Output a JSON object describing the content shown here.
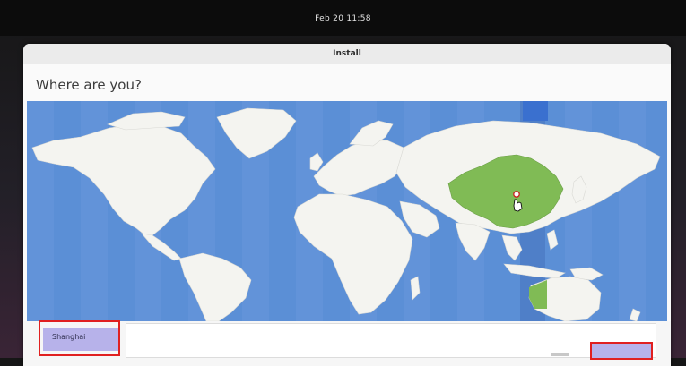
{
  "system": {
    "clock": "Feb 20  11:58"
  },
  "window": {
    "title": "Install"
  },
  "page": {
    "heading": "Where are you?"
  },
  "location": {
    "timezone_entry": "Shanghai"
  },
  "colors": {
    "ocean": "#5b8fd6",
    "land": "#f4f4f0",
    "selected_region": "#80bb55",
    "selected_strip": "#4f7fc8",
    "highlight_box": "#e02020",
    "selection_fill": "#b7b2ea"
  },
  "icons": {
    "map_pin": "map-pin-icon",
    "cursor": "hand-cursor-icon"
  }
}
